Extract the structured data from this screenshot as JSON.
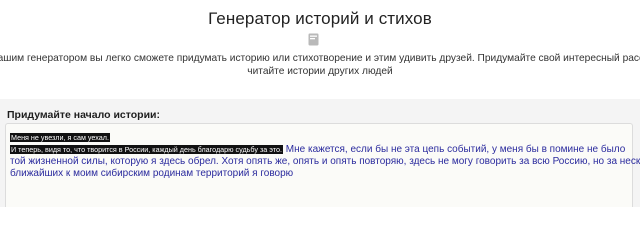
{
  "header": {
    "title": "Генератор историй и стихов",
    "icon": "book-icon"
  },
  "intro": {
    "line1": "нашим генератором вы легко сможете придумать историю или стихотворение и этим удивить друзей. Придумайте свой интересный рассказ, а так же",
    "line2": "читайте истории других людей"
  },
  "prompt": {
    "label": "Придумайте начало истории:",
    "highlighted_line1": "Меня не увезли, я сам уехал.",
    "highlighted_line2": "И теперь, видя то, что творится в России, каждый день благодарю судьбу за это.",
    "generated_line2_tail": " Мне кажется, если бы не эта цепь событий, у меня бы в помине не было",
    "generated_line3": "той жизненной силы, которую я здесь обрел.  Хотя опять же, опять и опять повторяю, здесь не могу говорить за всю Россию, но за несколько",
    "generated_line4": "ближайших к моим сибирским родинам территорий я говорю"
  },
  "colors": {
    "panel_bg": "#f4f4f4",
    "generated_text": "#2b2b9e",
    "highlight_bg": "#111111"
  }
}
